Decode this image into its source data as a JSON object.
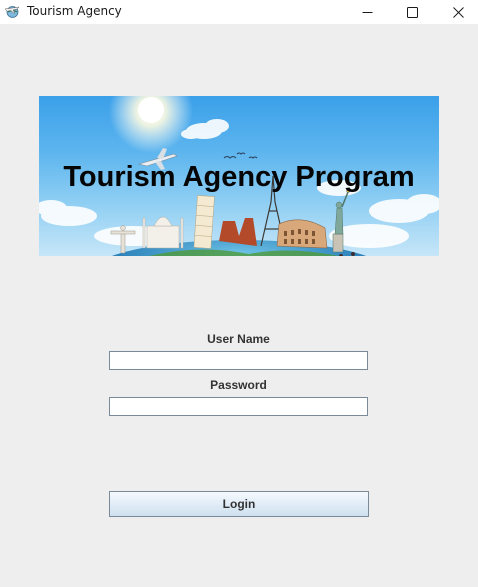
{
  "window": {
    "title": "Tourism Agency",
    "app_icon": "airplane-globe-icon",
    "controls": {
      "minimize_icon": "minimize-icon",
      "maximize_icon": "maximize-icon",
      "close_icon": "close-icon"
    }
  },
  "banner": {
    "title": "Tourism Agency Program",
    "landmarks": [
      "christ-the-redeemer",
      "taj-mahal",
      "leaning-tower-of-pisa",
      "eiffel-tower",
      "colosseum",
      "statue-of-liberty",
      "airplane",
      "globe"
    ]
  },
  "login_form": {
    "username_label": "User Name",
    "username_value": "",
    "password_label": "Password",
    "password_value": "",
    "login_button": "Login"
  },
  "colors": {
    "window_background": "#eeeeee",
    "titlebar_background": "#ffffff",
    "sky": "#3ba0e9",
    "field_border": "#7a8a99"
  }
}
